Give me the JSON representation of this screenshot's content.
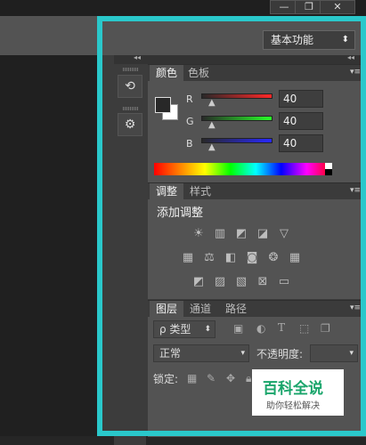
{
  "window": {
    "minimize_glyph": "—",
    "maximize_glyph": "❐",
    "close_glyph": "✕"
  },
  "options_bar": {
    "workspace_label": "基本功能",
    "workspace_arrow": "⬍"
  },
  "collapse_glyph": "◂◂",
  "color_panel": {
    "tabs": [
      "颜色",
      "色板"
    ],
    "channels": [
      {
        "label": "R",
        "value": "40",
        "color": "#e23a3a"
      },
      {
        "label": "G",
        "value": "40",
        "color": "#3ac23a"
      },
      {
        "label": "B",
        "value": "40",
        "color": "#3a3ae2"
      }
    ],
    "foreground": "#282828",
    "background": "#ffffff"
  },
  "adjustments_panel": {
    "tabs": [
      "调整",
      "样式"
    ],
    "title": "添加调整",
    "icons": {
      "row1": [
        "brightness-icon",
        "levels-icon",
        "curves-icon",
        "exposure-icon",
        "vibrance-icon"
      ],
      "row2": [
        "hue-saturation-icon",
        "color-balance-icon",
        "black-white-icon",
        "photo-filter-icon",
        "channel-mixer-icon",
        "color-lookup-icon"
      ],
      "row3": [
        "invert-icon",
        "posterize-icon",
        "threshold-icon",
        "selective-color-icon",
        "gradient-map-icon"
      ]
    }
  },
  "layers_panel": {
    "tabs": [
      "图层",
      "通道",
      "路径"
    ],
    "filter_label": "ρ 类型",
    "blend_mode": "正常",
    "opacity_label": "不透明度:",
    "lock_label": "锁定:"
  },
  "icon_strip": {
    "history_glyph": "⟲",
    "properties_glyph": "⚙"
  },
  "watermark": {
    "title": "百科全说",
    "subtitle": "助你轻松解决"
  },
  "highlight_color": "#2ac8cb"
}
